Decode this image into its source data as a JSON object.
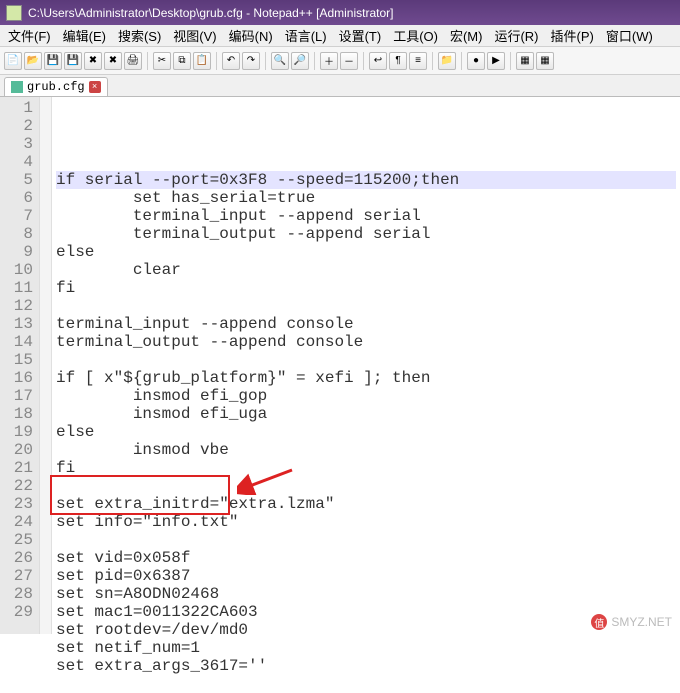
{
  "title": "C:\\Users\\Administrator\\Desktop\\grub.cfg - Notepad++ [Administrator]",
  "menu": [
    "文件(F)",
    "编辑(E)",
    "搜索(S)",
    "视图(V)",
    "编码(N)",
    "语言(L)",
    "设置(T)",
    "工具(O)",
    "宏(M)",
    "运行(R)",
    "插件(P)",
    "窗口(W)"
  ],
  "tab": {
    "name": "grub.cfg"
  },
  "code_lines": [
    "if serial --port=0x3F8 --speed=115200;then",
    "        set has_serial=true",
    "        terminal_input --append serial",
    "        terminal_output --append serial",
    "else",
    "        clear",
    "fi",
    "",
    "terminal_input --append console",
    "terminal_output --append console",
    "",
    "if [ x\"${grub_platform}\" = xefi ]; then",
    "        insmod efi_gop",
    "        insmod efi_uga",
    "else",
    "        insmod vbe",
    "fi",
    "",
    "set extra_initrd=\"extra.lzma\"",
    "set info=\"info.txt\"",
    "",
    "set vid=0x058f",
    "set pid=0x6387",
    "set sn=A8ODN02468",
    "set mac1=0011322CA603",
    "set rootdev=/dev/md0",
    "set netif_num=1",
    "set extra_args_3617=''",
    ""
  ],
  "highlighted_line_index": 0,
  "box": {
    "start": 22,
    "end": 23
  },
  "watermark": {
    "badge": "值",
    "text": "SMYZ.NET"
  },
  "toolbar_icons": [
    "new-icon",
    "open-icon",
    "save-icon",
    "saveall-icon",
    "close-icon",
    "closeall-icon",
    "print-icon",
    "sep",
    "cut-icon",
    "copy-icon",
    "paste-icon",
    "sep",
    "undo-icon",
    "redo-icon",
    "sep",
    "find-icon",
    "replace-icon",
    "sep",
    "zoomin-icon",
    "zoomout-icon",
    "sep",
    "wrap-icon",
    "allchars-icon",
    "indent-icon",
    "sep",
    "folder-icon",
    "sep",
    "record-icon",
    "play-icon",
    "sep",
    "macro1-icon",
    "macro2-icon"
  ]
}
